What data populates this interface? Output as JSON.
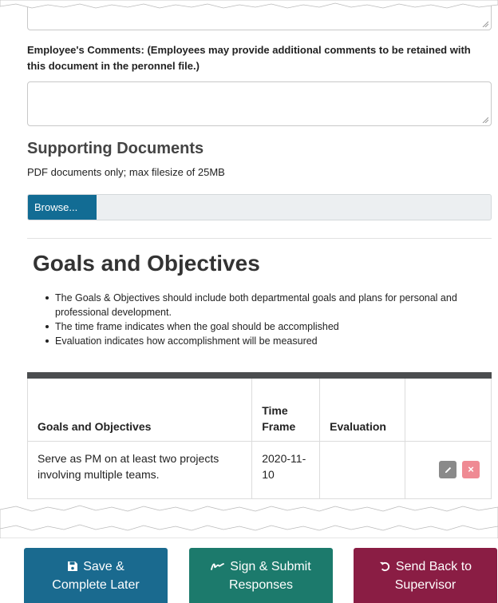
{
  "comments": {
    "label": "Employee's Comments: (Employees may provide additional comments to be retained with this document in the peronnel file.)"
  },
  "supporting_documents": {
    "title": "Supporting Documents",
    "help": "PDF documents only; max filesize of 25MB",
    "browse_label": "Browse..."
  },
  "goals": {
    "title": "Goals and Objectives",
    "bullets": [
      "The Goals & Objectives should include both departmental goals and plans for personal and professional development.",
      "The time frame indicates when the goal should be accomplished",
      "Evaluation indicates how accomplishment will be measured"
    ],
    "table": {
      "headers": [
        "Goals and Objectives",
        "Time Frame",
        "Evaluation",
        ""
      ],
      "rows": [
        {
          "goal": "Serve as PM on at least two projects involving multiple teams.",
          "time_frame": "2020-11-10",
          "evaluation": ""
        }
      ]
    }
  },
  "footer": {
    "save": {
      "line1": "Save &",
      "line2": "Complete Later",
      "icon": "floppy-disk-icon"
    },
    "sign": {
      "line1": "Sign & Submit",
      "line2": "Responses",
      "icon": "signature-icon"
    },
    "back": {
      "line1": "Send Back to",
      "line2": "Supervisor",
      "icon": "undo-icon"
    }
  },
  "colors": {
    "browse": "#126c94",
    "save": "#1a6a8f",
    "sign": "#1c7a6c",
    "back": "#8a1d44",
    "table_header_bar": "#4b4d4f"
  }
}
